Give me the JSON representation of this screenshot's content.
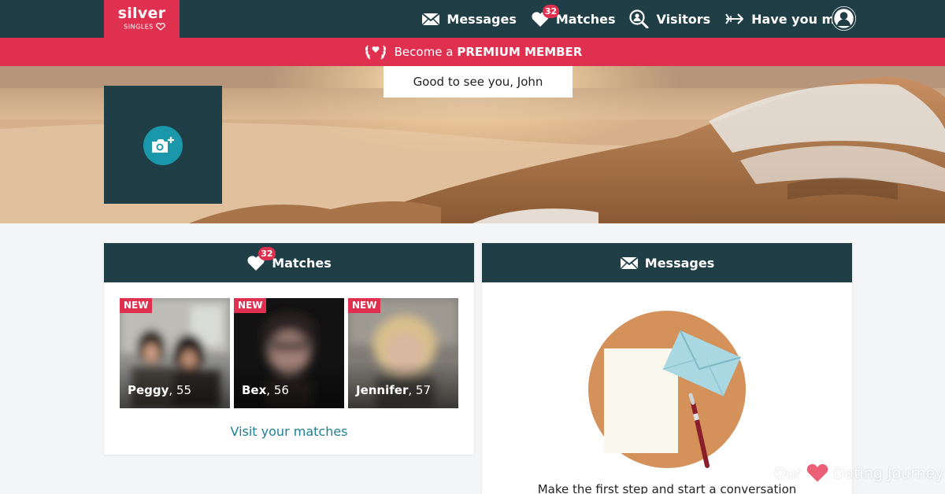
{
  "logo": {
    "main": "silver",
    "sub": "SINGLES"
  },
  "nav": {
    "messages_label": "Messages",
    "matches_label": "Matches",
    "matches_badge": "32",
    "visitors_label": "Visitors",
    "have_you_met_label": "Have you met?"
  },
  "premium": {
    "prefix": "Become a",
    "emphasis": "PREMIUM MEMBER"
  },
  "greeting": "Good to see you, John",
  "matches_card": {
    "title": "Matches",
    "badge": "32",
    "tiles": [
      {
        "badge": "NEW",
        "name": "Peggy",
        "age": ", 55"
      },
      {
        "badge": "NEW",
        "name": "Bex",
        "age": ", 56"
      },
      {
        "badge": "NEW",
        "name": "Jennifer",
        "age": ", 57"
      }
    ],
    "visit_link": "Visit your matches"
  },
  "messages_card": {
    "title": "Messages",
    "prompt": "Make the first step and start a conversation"
  },
  "watermark": {
    "left": "Our",
    "right": "Dating Journey"
  },
  "colors": {
    "nav_bg": "#1f3e46",
    "brand_red": "#e0304f",
    "accent_teal": "#1a97aa",
    "link_teal": "#1d7f93",
    "illustration_orange": "#d4915a"
  },
  "icons": {
    "nav_messages": "envelope-icon",
    "nav_matches": "heart-icon",
    "nav_visitors": "magnifier-person-icon",
    "nav_have_you_met": "arrow-icon",
    "nav_profile": "user-avatar-icon",
    "premium": "laurel-heart-icon",
    "photo_upload": "camera-plus-icon"
  }
}
